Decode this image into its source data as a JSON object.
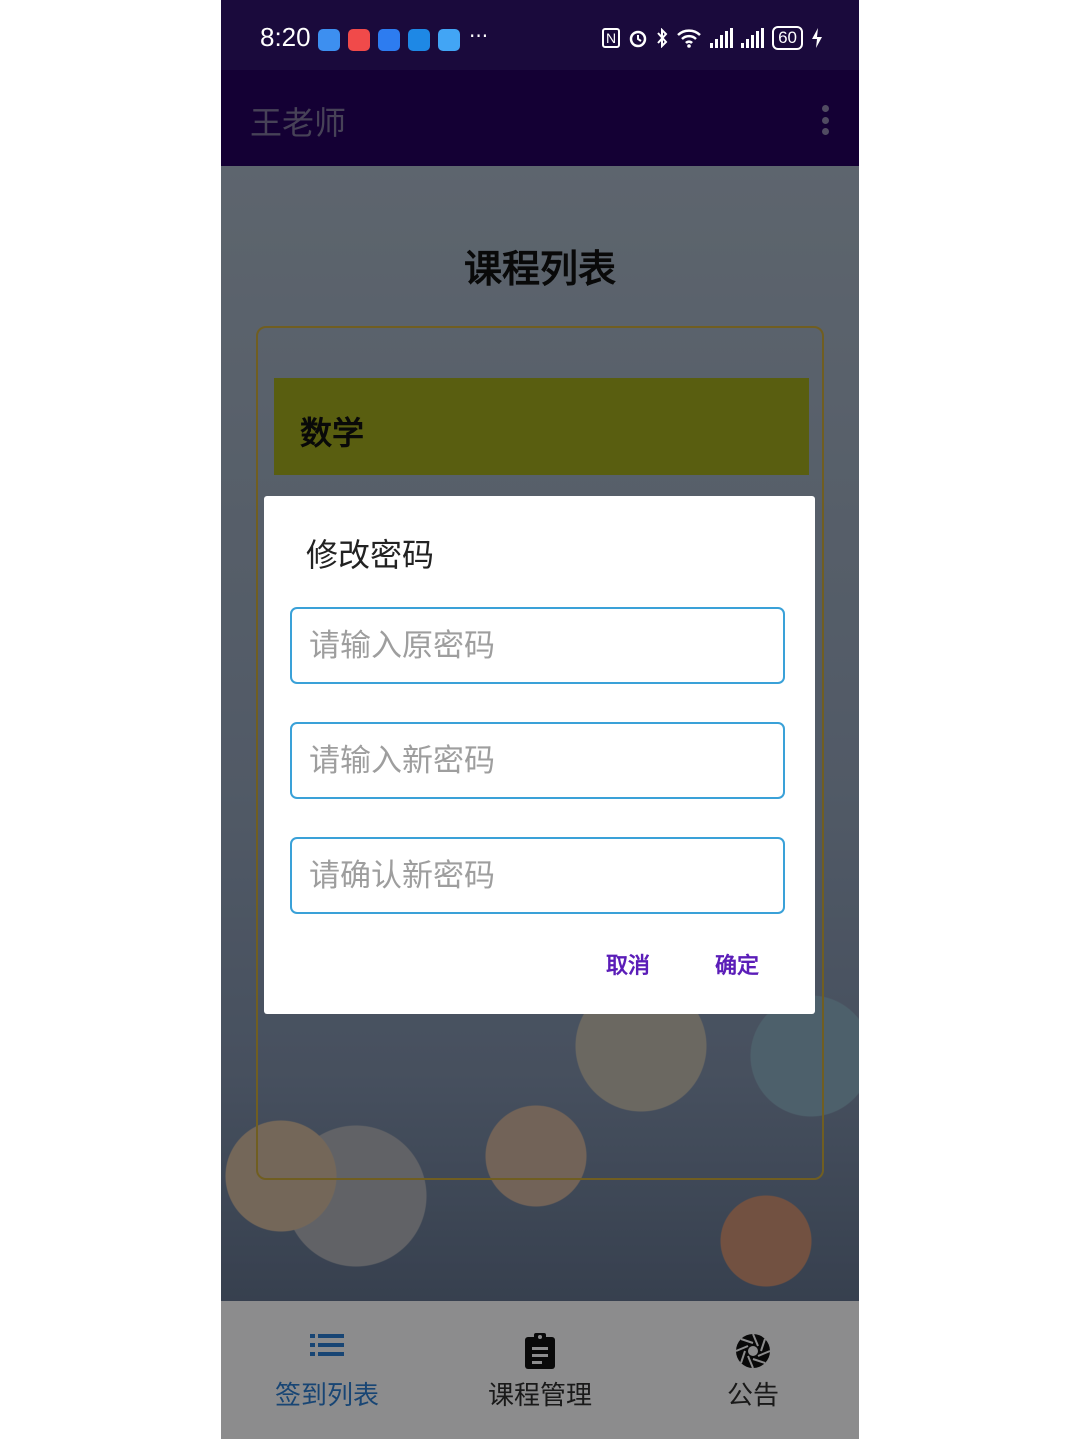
{
  "status_bar": {
    "time": "8:20",
    "notification_icons": [
      "usb-icon",
      "app-red-icon",
      "message-icon",
      "app-blue-icon",
      "app-lightblue-icon"
    ],
    "more": "···",
    "nfc": "N",
    "battery": "60"
  },
  "app_bar": {
    "title": "王老师"
  },
  "page": {
    "title": "课程列表",
    "courses": [
      {
        "name": "数学"
      }
    ]
  },
  "dialog": {
    "title": "修改密码",
    "fields": [
      {
        "placeholder": "请输入原密码",
        "value": ""
      },
      {
        "placeholder": "请输入新密码",
        "value": ""
      },
      {
        "placeholder": "请确认新密码",
        "value": ""
      }
    ],
    "cancel": "取消",
    "confirm": "确定"
  },
  "bottom_nav": {
    "items": [
      {
        "label": "签到列表",
        "icon": "list-icon",
        "active": true
      },
      {
        "label": "课程管理",
        "icon": "clipboard-icon",
        "active": false
      },
      {
        "label": "公告",
        "icon": "aperture-icon",
        "active": false
      }
    ]
  },
  "colors": {
    "app_bar": "#24005b",
    "accent": "#5b1db8",
    "active_nav": "#2a78c8",
    "field_border": "#3aa1d8",
    "course_item": "#9aa31c"
  }
}
